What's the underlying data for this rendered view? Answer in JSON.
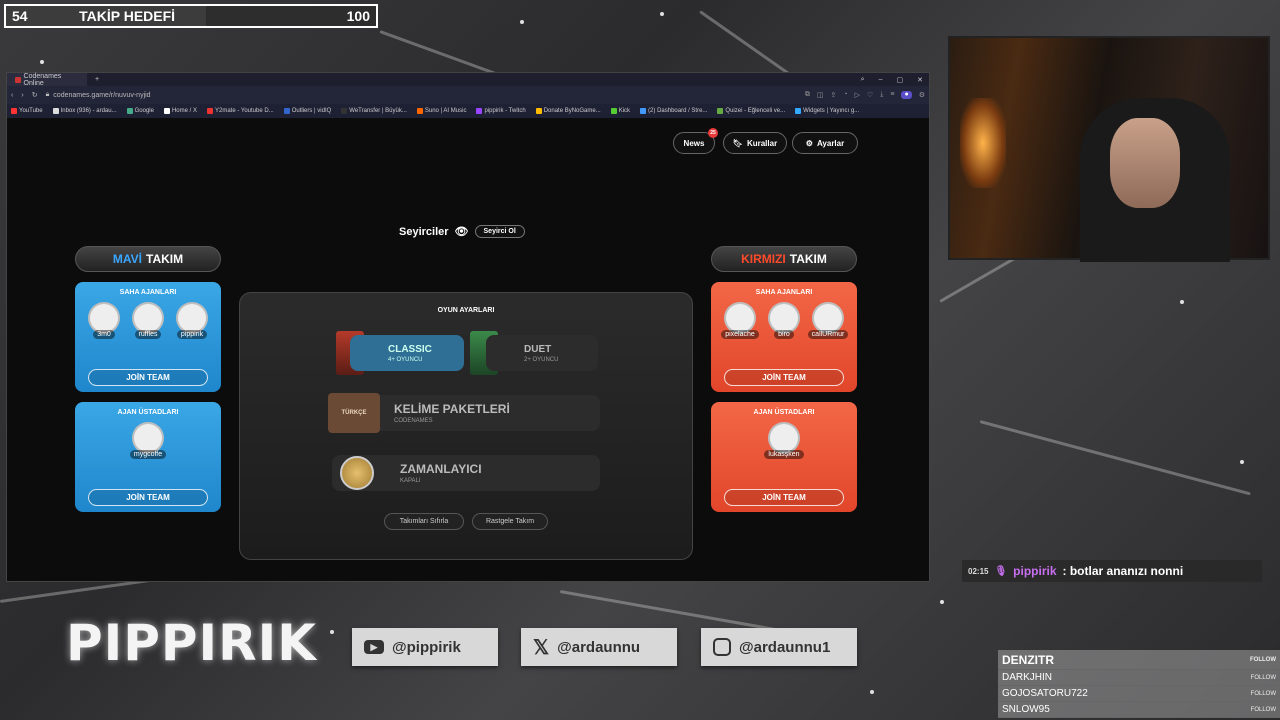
{
  "goal": {
    "current": "54",
    "title": "TAKİP HEDEFİ",
    "target": "100",
    "progress": 0.54
  },
  "browser": {
    "tab_title": "Codenames Online",
    "url": "codenames.game/r/nuvuv-nyjid",
    "bookmarks": [
      "YouTube",
      "Inbox (936) - ardau...",
      "Google",
      "Home / X",
      "Y2mate - Youtube D...",
      "Outliers | vidIQ",
      "WeTransfer | Büyük...",
      "Suno | AI Music",
      "pippirik - Twitch",
      "Donate ByNoGame...",
      "Kick",
      "(2) Dashboard / Stre...",
      "Quizei - Eğlenceli ve...",
      "Widgets | Yayıncı g..."
    ]
  },
  "game": {
    "top_buttons": {
      "news": "News",
      "news_badge": "25",
      "rules": "Kurallar",
      "settings": "Ayarlar"
    },
    "spectators": {
      "label": "Seyirciler",
      "button": "Seyirci Ol"
    },
    "blue": {
      "head_accent": "MAVİ",
      "head_rest": "TAKIM",
      "field_title": "SAHA AJANLARI",
      "field_players": [
        "3m0",
        "ruffles",
        "pippirik"
      ],
      "spymaster_title": "AJAN ÜSTADLARI",
      "spymasters": [
        "mygcoffe"
      ],
      "join": "JOİN TEAM"
    },
    "red": {
      "head_accent": "KIRMIZI",
      "head_rest": "TAKIM",
      "field_title": "SAHA AJANLARI",
      "field_players": [
        "pixelache",
        "biro",
        "callURmur"
      ],
      "spymaster_title": "AJAN ÜSTADLARI",
      "spymasters": [
        "lukasşken"
      ],
      "join": "JOİN TEAM"
    },
    "settings": {
      "title": "OYUN AYARLARI",
      "classic": {
        "name": "CLASSIC",
        "sub": "4+ OYUNCU"
      },
      "duet": {
        "name": "DUET",
        "sub": "2+ OYUNCU"
      },
      "words": {
        "name": "KELİME PAKETLERİ",
        "sub": "CODENAMES",
        "tag": "TÜRKÇE"
      },
      "timer": {
        "name": "ZAMANLAYICI",
        "sub": "KAPALI"
      },
      "reset": "Takımları Sıfırla",
      "random": "Rastgele Takım"
    }
  },
  "chat": {
    "time": "02:15",
    "user": "pippirik",
    "message": ": botlar ananızı nonni"
  },
  "branding": {
    "logo": "PIPPIRIK"
  },
  "socials": [
    {
      "icon": "youtube-icon",
      "handle": "@pippirik"
    },
    {
      "icon": "x-icon",
      "handle": "@ardaunnu"
    },
    {
      "icon": "instagram-icon",
      "handle": "@ardaunnu1"
    }
  ],
  "followers": {
    "top": "DENZITR",
    "list": [
      "DARKJHIN",
      "GOJOSATORU722",
      "SNLOW95"
    ],
    "follow_label": "FOLLOW"
  }
}
